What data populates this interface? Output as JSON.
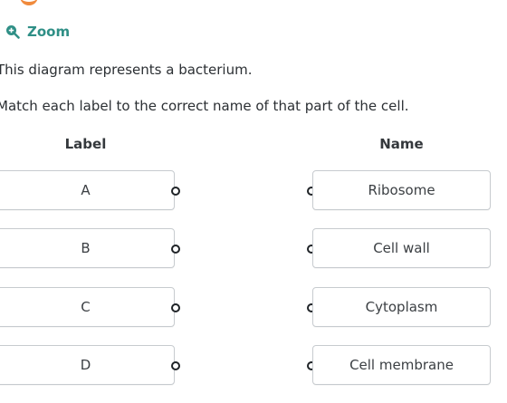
{
  "zoom": {
    "label": "Zoom",
    "icon": "zoom-in-icon"
  },
  "description": "This diagram represents a bacterium.",
  "instruction": "Match each label to the correct name of that part of the cell.",
  "columns": {
    "label_header": "Label",
    "name_header": "Name"
  },
  "labels": [
    "A",
    "B",
    "C",
    "D"
  ],
  "names": [
    "Ribosome",
    "Cell wall",
    "Cytoplasm",
    "Cell membrane"
  ],
  "colors": {
    "accent": "#2f8f86",
    "graphic": "#f08a3c"
  }
}
